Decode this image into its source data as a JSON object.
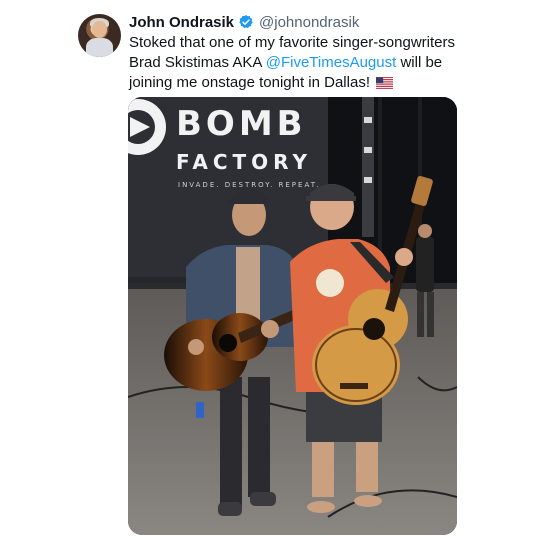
{
  "tweet": {
    "author_name": "John Ondrasik",
    "author_handle": "@johnondrasik",
    "verified": true,
    "text_part1": "Stoked that one of my favorite singer-songwriters Brad Skistimas AKA ",
    "mention": "@FiveTimesAugust",
    "text_part2": " will be joining me onstage tonight in Dallas! ",
    "flag_emoji": "us-flag-icon"
  },
  "media": {
    "backdrop_title_line1": "BOMB",
    "backdrop_title_line2": "FACTORY",
    "backdrop_tagline": "INVADE. DESTROY. REPEAT."
  },
  "colors": {
    "link": "#1d9bf0",
    "verified_badge": "#1d9bf0",
    "handle_gray": "#536471",
    "text": "#0f1419"
  }
}
